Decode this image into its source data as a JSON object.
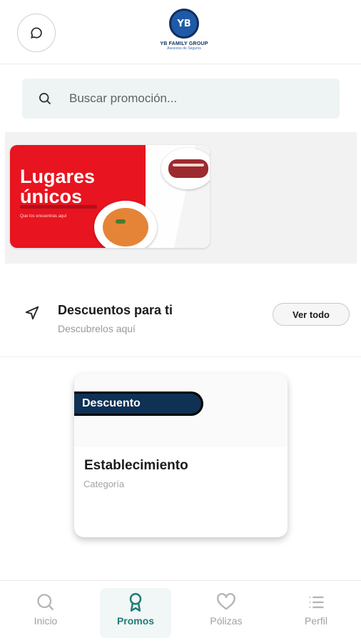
{
  "header": {
    "logo_text": "YB",
    "logo_name": "YB FAMILY GROUP",
    "logo_subtitle": "Asesores de Seguros"
  },
  "search": {
    "placeholder": "Buscar promoción..."
  },
  "banner": {
    "title_line1": "Lugares",
    "title_line2": "únicos",
    "subtitle": "Que los encuentras aquí"
  },
  "section": {
    "title": "Descuentos para ti",
    "subtitle": "Descubrelos aquí",
    "see_all_label": "Ver todo"
  },
  "card": {
    "badge": "Descuento",
    "title": "Establecimiento",
    "category": "Categoría"
  },
  "bottom_nav": {
    "items": [
      {
        "label": "Inicio",
        "icon": "search-icon",
        "active": false
      },
      {
        "label": "Promos",
        "icon": "award-icon",
        "active": true
      },
      {
        "label": "Pólizas",
        "icon": "heart-icon",
        "active": false
      },
      {
        "label": "Perfil",
        "icon": "list-icon",
        "active": false
      }
    ]
  },
  "colors": {
    "accent": "#1f7d78",
    "banner_red": "#e8141f",
    "badge_navy": "#0f3154",
    "search_bg": "#eef4f4"
  }
}
